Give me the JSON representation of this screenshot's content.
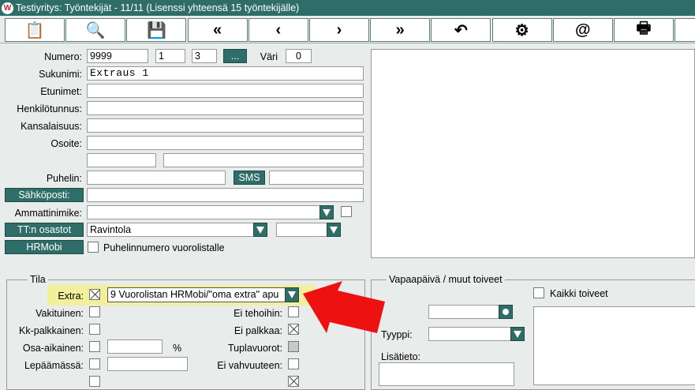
{
  "window": {
    "title": "Testiyritys: Työntekijät - 11/11 (Lisenssi yhteensä 15 työntekijälle)",
    "logo_text": "W"
  },
  "toolbar": {
    "buttons": [
      {
        "name": "clipboard-icon",
        "glyph": "📋"
      },
      {
        "name": "search-icon",
        "glyph": "🔍"
      },
      {
        "name": "save-icon",
        "glyph": "💾"
      },
      {
        "name": "first-record-icon",
        "glyph": "«"
      },
      {
        "name": "previous-record-icon",
        "glyph": "‹"
      },
      {
        "name": "next-record-icon",
        "glyph": "›"
      },
      {
        "name": "last-record-icon",
        "glyph": "»"
      },
      {
        "name": "undo-icon",
        "glyph": "↶"
      },
      {
        "name": "settings-icon",
        "glyph": "⚙"
      },
      {
        "name": "email-icon",
        "glyph": "@"
      },
      {
        "name": "print-icon",
        "glyph": "🖶"
      }
    ]
  },
  "form": {
    "numero_label": "Numero:",
    "numero_value": "9999",
    "numero_sub1": "1",
    "numero_sub2": "3",
    "ellipsis_label": "...",
    "vari_label": "Väri",
    "vari_value": "0",
    "sukunimi_label": "Sukunimi:",
    "sukunimi_value": "Extraus 1",
    "etunimet_label": "Etunimet:",
    "etunimet_value": "",
    "henkilotunnus_label": "Henkilötunnus:",
    "henkilotunnus_value": "",
    "kansalaisuus_label": "Kansalaisuus:",
    "kansalaisuus_value": "",
    "osoite_label": "Osoite:",
    "osoite_value": "",
    "puhelin_label": "Puhelin:",
    "puhelin_value": "",
    "sms_label": "SMS",
    "sahkoposti_label": "Sähköposti:",
    "sahkoposti_value": "",
    "ammattinimike_label": "Ammattinimike:",
    "ammattinimike_value": "",
    "tt_osastot_label": "TT:n osastot",
    "tt_osastot_value": "Ravintola",
    "tt_osastot_value2": "",
    "hrmobi_label": "HRMobi",
    "puhelinnumero_label": "Puhelinnumero vuorolistalle"
  },
  "tila": {
    "legend": "Tila",
    "extra_label": "Extra:",
    "extra_value": "9 Vuorolistan HRMobi/\"oma extra\" apu",
    "vakituinen_label": "Vakituinen:",
    "kk_palkkainen_label": "Kk-palkkainen:",
    "osa_aikainen_label": "Osa-aikainen:",
    "percent_label": "%",
    "lepaamassa_label": "Lepäämässä:",
    "ei_tehoihin_label": "Ei tehoihin:",
    "ei_palkkaa_label": "Ei palkkaa:",
    "tuplavuorot_label": "Tuplavuorot:",
    "ei_vahvuuteen_label": "Ei vahvuuteen:"
  },
  "vapaapaiva": {
    "legend": "Vapaapäivä / muut toiveet",
    "kaikki_toiveet_label": "Kaikki toiveet",
    "tyyppi_label": "Tyyppi:",
    "lisatieto_label": "Lisätieto:"
  },
  "colors": {
    "accent": "#2f6e68",
    "highlight": "#f2f09a",
    "arrow": "#ee1111"
  }
}
